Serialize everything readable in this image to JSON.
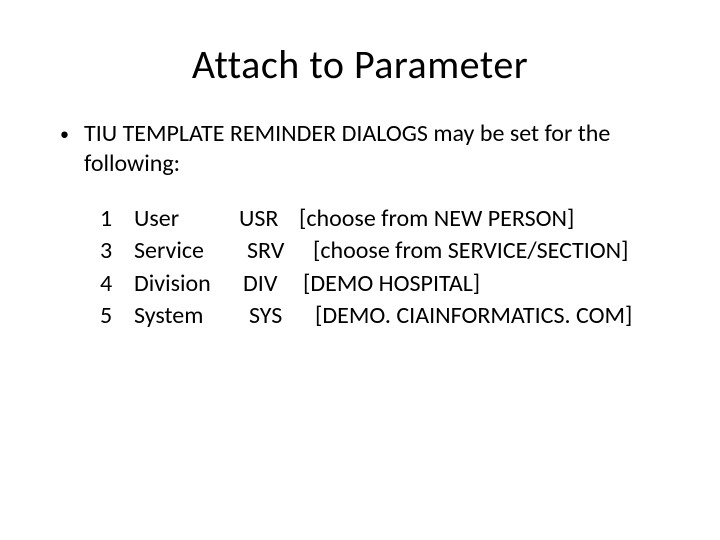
{
  "title": "Attach to Parameter",
  "bullet": "TIU TEMPLATE REMINDER DIALOGS may be set for the following:",
  "rows": [
    {
      "num": "1",
      "name": "User",
      "code": "USR",
      "desc": "[choose from NEW PERSON]"
    },
    {
      "num": "3",
      "name": "Service",
      "code": "SRV",
      "desc": "[choose from SERVICE/SECTION]"
    },
    {
      "num": "4",
      "name": "Division",
      "code": "DIV",
      "desc": "[DEMO HOSPITAL]"
    },
    {
      "num": "5",
      "name": "System",
      "code": "SYS",
      "desc": "[DEMO. CIAINFORMATICS. COM]"
    }
  ]
}
